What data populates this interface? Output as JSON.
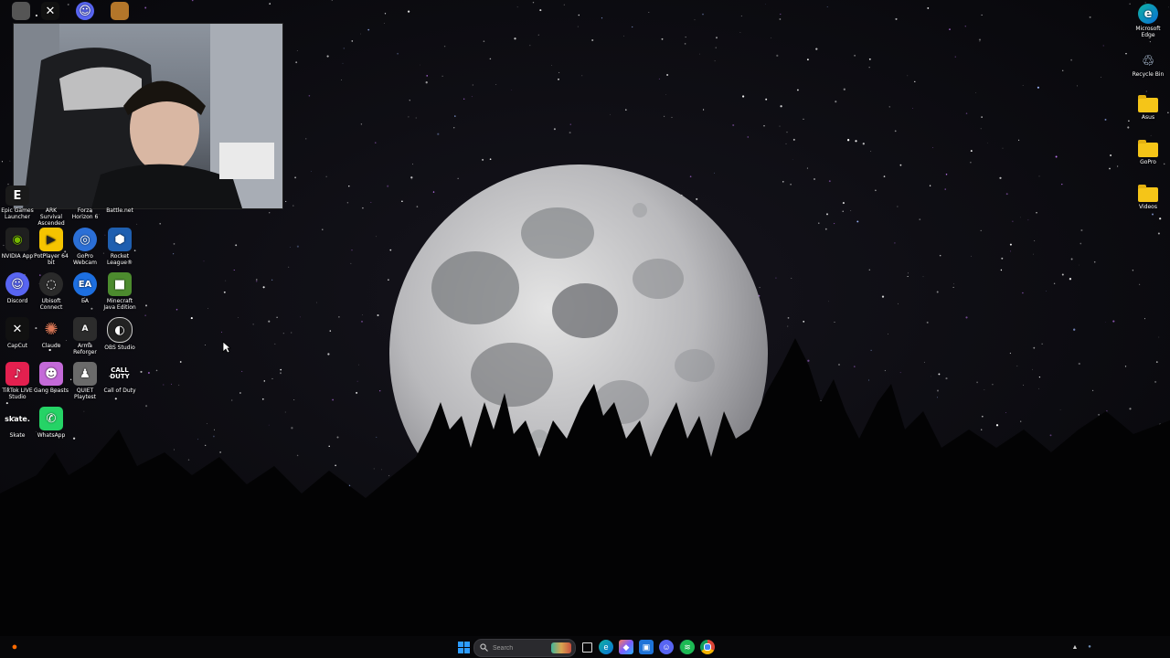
{
  "desktop_icons": {
    "row1_labels": [
      "Epic Games Launcher",
      "ARK Survival Ascended",
      "Forza Horizon 6",
      "Battle.net"
    ],
    "nvidia": "NVIDIA App",
    "potplayer": "PotPlayer 64 bit",
    "gopro_webcam": "GoPro Webcam",
    "rocket_league": "Rocket League®",
    "discord": "Discord",
    "ubisoft": "Ubisoft Connect",
    "ea": "EA",
    "minecraft": "Minecraft Java Edition",
    "capcut": "CapCut",
    "claude": "Claude",
    "arma": "Arma Reforger",
    "obs": "OBS Studio",
    "tiktok": "TikTok LIVE Studio",
    "gang_beasts": "Gang Beasts",
    "quiet": "QUIET Playtest",
    "cod": "Call of Duty",
    "skate": "Skate",
    "whatsapp": "WhatsApp"
  },
  "right_icons": {
    "edge": "Microsoft Edge",
    "recycle": "Recycle Bin",
    "asus": "Asus",
    "gopro": "GoPro",
    "videos": "Videos"
  },
  "taskbar": {
    "search_placeholder": "Search"
  },
  "colors": {
    "taskbar": "#08080a",
    "accent": "#0a84ff"
  }
}
